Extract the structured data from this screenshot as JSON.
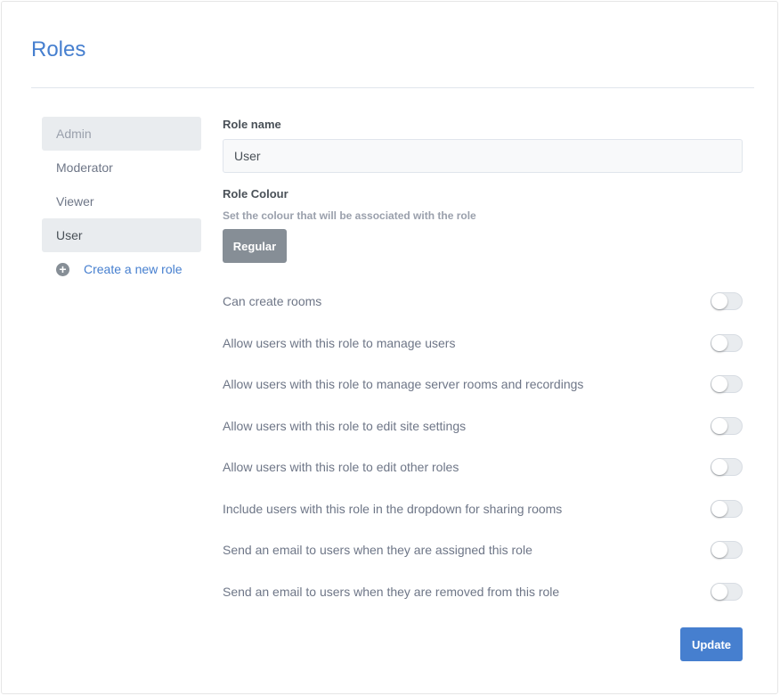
{
  "page": {
    "title": "Roles"
  },
  "sidebar": {
    "roles": [
      {
        "label": "Admin",
        "state": "disabled"
      },
      {
        "label": "Moderator",
        "state": "normal"
      },
      {
        "label": "Viewer",
        "state": "normal"
      },
      {
        "label": "User",
        "state": "selected"
      }
    ],
    "create_label": "Create a new role",
    "create_icon": "plus-circle-icon"
  },
  "form": {
    "role_name_label": "Role name",
    "role_name_value": "User",
    "role_colour_label": "Role Colour",
    "role_colour_hint": "Set the colour that will be associated with the role",
    "role_colour_button": "Regular",
    "role_colour_value": "#868e96",
    "permissions": [
      {
        "label": "Can create rooms",
        "enabled": false
      },
      {
        "label": "Allow users with this role to manage users",
        "enabled": false
      },
      {
        "label": "Allow users with this role to manage server rooms and recordings",
        "enabled": false
      },
      {
        "label": "Allow users with this role to edit site settings",
        "enabled": false
      },
      {
        "label": "Allow users with this role to edit other roles",
        "enabled": false
      },
      {
        "label": "Include users with this role in the dropdown for sharing rooms",
        "enabled": false
      },
      {
        "label": "Send an email to users when they are assigned this role",
        "enabled": false
      },
      {
        "label": "Send an email to users when they are removed from this role",
        "enabled": false
      }
    ],
    "update_label": "Update"
  },
  "colors": {
    "accent": "#467fcf",
    "selected_bg": "#e9ecef",
    "muted": "#868e96"
  }
}
